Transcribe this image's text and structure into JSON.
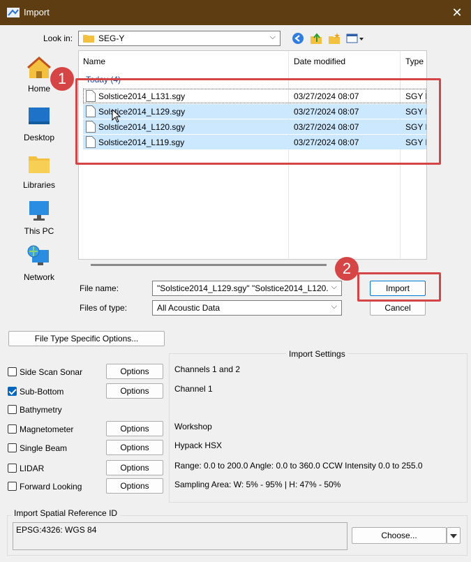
{
  "window": {
    "title": "Import",
    "close_glyph": "✕"
  },
  "lookin": {
    "label": "Look in:",
    "value": "SEG-Y"
  },
  "places": [
    {
      "label": "Home",
      "icon": "home-icon"
    },
    {
      "label": "Desktop",
      "icon": "desktop-icon"
    },
    {
      "label": "Libraries",
      "icon": "libraries-icon"
    },
    {
      "label": "This PC",
      "icon": "this-pc-icon"
    },
    {
      "label": "Network",
      "icon": "network-icon"
    }
  ],
  "filelist": {
    "columns": [
      "Name",
      "Date modified",
      "Type"
    ],
    "group": "Today (4)",
    "rows": [
      {
        "name": "Solstice2014_L131.sgy",
        "date": "03/27/2024 08:07",
        "type": "SGY F"
      },
      {
        "name": "Solstice2014_L129.sgy",
        "date": "03/27/2024 08:07",
        "type": "SGY F"
      },
      {
        "name": "Solstice2014_L120.sgy",
        "date": "03/27/2024 08:07",
        "type": "SGY F"
      },
      {
        "name": "Solstice2014_L119.sgy",
        "date": "03/27/2024 08:07",
        "type": "SGY F"
      }
    ]
  },
  "filename": {
    "label": "File name:",
    "value": "\"Solstice2014_L129.sgy\" \"Solstice2014_L120."
  },
  "filetype": {
    "label": "Files of type:",
    "value": "All Acoustic Data"
  },
  "buttons": {
    "import": "Import",
    "cancel": "Cancel",
    "file_type_options": "File Type Specific Options...",
    "options": "Options",
    "choose": "Choose..."
  },
  "import_settings": {
    "title": "Import Settings",
    "data_types": [
      {
        "label": "Side Scan Sonar",
        "checked": false,
        "has_options": true,
        "setting": "Channels 1 and 2"
      },
      {
        "label": "Sub-Bottom",
        "checked": true,
        "has_options": true,
        "setting": "Channel 1"
      },
      {
        "label": "Bathymetry",
        "checked": false,
        "has_options": false,
        "setting": ""
      },
      {
        "label": "Magnetometer",
        "checked": false,
        "has_options": true,
        "setting": "Workshop"
      },
      {
        "label": "Single Beam",
        "checked": false,
        "has_options": true,
        "setting": "Hypack HSX"
      },
      {
        "label": "LIDAR",
        "checked": false,
        "has_options": true,
        "setting": "Range: 0.0 to 200.0  Angle: 0.0 to 360.0 CCW  Intensity 0.0 to 255.0"
      },
      {
        "label": "Forward Looking",
        "checked": false,
        "has_options": true,
        "setting": "Sampling Area: W: 5% - 95% | H: 47% - 50%"
      }
    ]
  },
  "spatial_ref": {
    "title": "Import Spatial Reference ID",
    "value": "EPSG:4326: WGS 84"
  },
  "annotations": [
    "1",
    "2"
  ],
  "colors": {
    "titlebar": "#5e3d12",
    "selection": "#cce8ff",
    "annotation": "#d64545",
    "accent": "#0067c0"
  }
}
